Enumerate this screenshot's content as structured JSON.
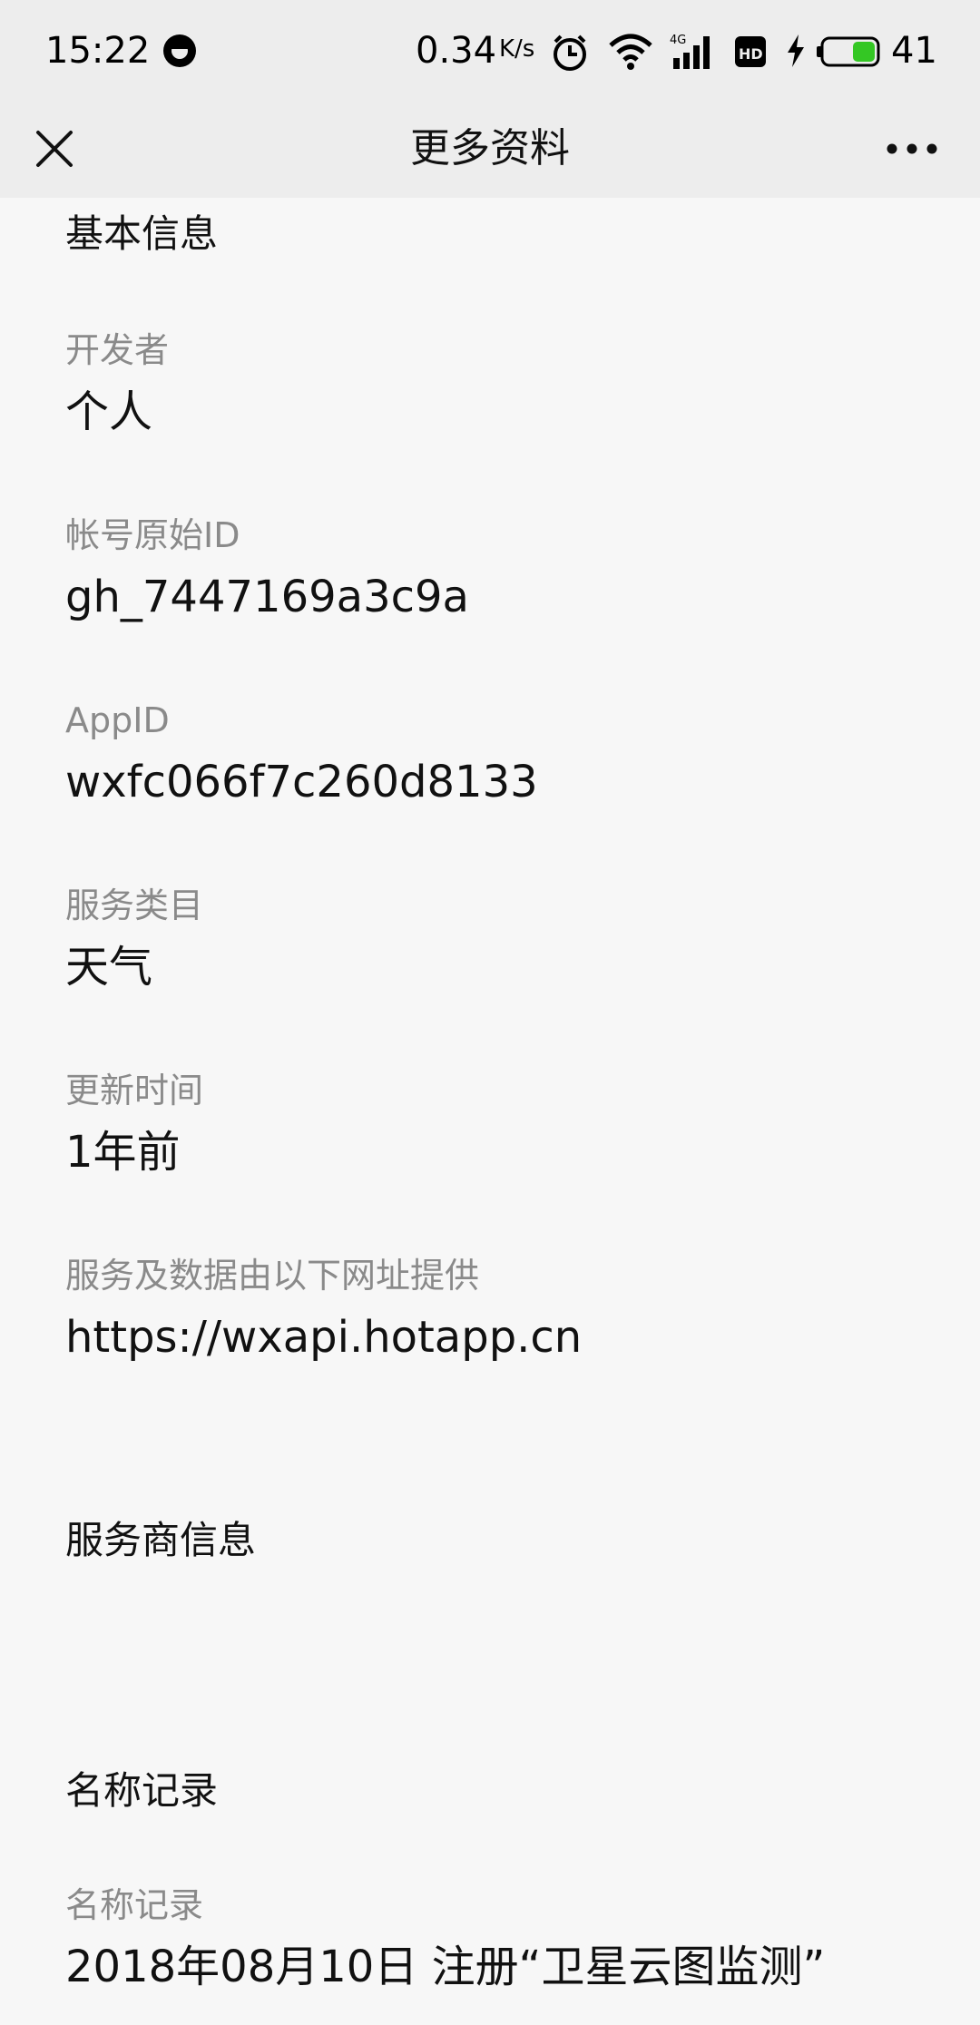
{
  "status_bar": {
    "time": "15:22",
    "speed": "0.34",
    "speed_unit": "K/s",
    "battery": "41",
    "icons": [
      "alarm-icon",
      "wifi-icon",
      "4g-signal-icon",
      "hd-icon",
      "charging-icon",
      "battery-icon"
    ]
  },
  "nav": {
    "title": "更多资料",
    "close_icon": "close-icon",
    "more_icon": "more-icon"
  },
  "basic_info": {
    "title": "基本信息",
    "fields": [
      {
        "label": "开发者",
        "value": "个人"
      },
      {
        "label": "帐号原始ID",
        "value": "gh_7447169a3c9a"
      },
      {
        "label": "AppID",
        "value": "wxfc066f7c260d8133"
      },
      {
        "label": "服务类目",
        "value": "天气"
      },
      {
        "label": "更新时间",
        "value": "1年前"
      },
      {
        "label": "服务及数据由以下网址提供",
        "value": "https://wxapi.hotapp.cn"
      }
    ]
  },
  "provider_info": {
    "title": "服务商信息"
  },
  "name_record": {
    "title": "名称记录",
    "fields": [
      {
        "label": "名称记录",
        "value": "2018年08月10日 注册“卫星云图监测”"
      }
    ]
  },
  "colors": {
    "header_bg": "#ededed",
    "page_bg": "#f7f7f7",
    "label": "#8a8a8a",
    "text": "#111111",
    "battery_fill": "#34c724"
  }
}
